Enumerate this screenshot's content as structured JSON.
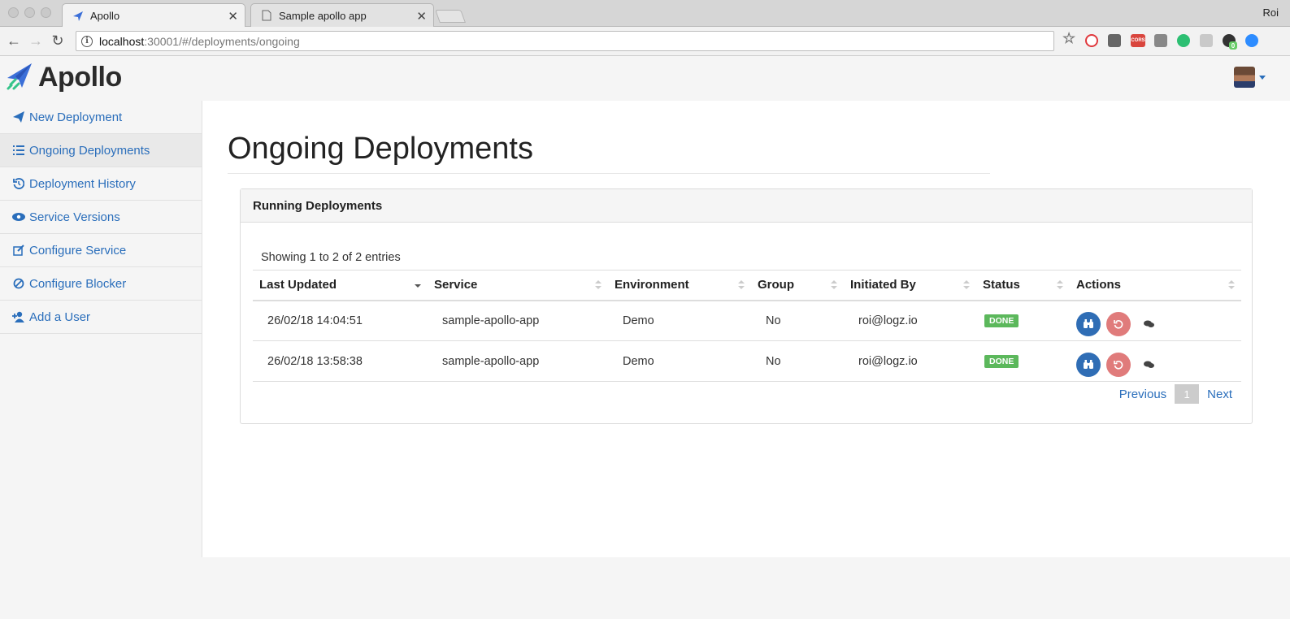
{
  "browser": {
    "tabs": [
      {
        "title": "Apollo",
        "active": true
      },
      {
        "title": "Sample apollo app",
        "active": false
      }
    ],
    "profile_name": "Roi",
    "url_host": "localhost",
    "url_path": ":30001/#/deployments/ongoing",
    "extensions": [
      "star-icon",
      "opera-icon",
      "pocket-icon",
      "cors-icon",
      "mail-icon",
      "grammarly-icon",
      "dropbox-icon",
      "github-icon",
      "zoom-icon"
    ],
    "cors_label": "CORS",
    "github_badge": "0"
  },
  "app": {
    "brand": "Apollo",
    "accent_color": "#2a6ebb"
  },
  "sidebar": {
    "items": [
      {
        "label": "New Deployment",
        "icon": "paper-plane-icon"
      },
      {
        "label": "Ongoing Deployments",
        "icon": "list-icon",
        "active": true
      },
      {
        "label": "Deployment History",
        "icon": "history-icon"
      },
      {
        "label": "Service Versions",
        "icon": "eye-icon"
      },
      {
        "label": "Configure Service",
        "icon": "edit-icon"
      },
      {
        "label": "Configure Blocker",
        "icon": "ban-icon"
      },
      {
        "label": "Add a User",
        "icon": "user-plus-icon"
      }
    ]
  },
  "main": {
    "title": "Ongoing Deployments",
    "panel_title": "Running Deployments",
    "entries_info": "Showing 1 to 2 of 2 entries",
    "columns": [
      "Last Updated",
      "Service",
      "Environment",
      "Group",
      "Initiated By",
      "Status",
      "Actions"
    ],
    "rows": [
      {
        "last_updated": "26/02/18 14:04:51",
        "service": "sample-apollo-app",
        "environment": "Demo",
        "group": "No",
        "initiated_by": "roi@logz.io",
        "status": "DONE"
      },
      {
        "last_updated": "26/02/18 13:58:38",
        "service": "sample-apollo-app",
        "environment": "Demo",
        "group": "No",
        "initiated_by": "roi@logz.io",
        "status": "DONE"
      }
    ],
    "pagination": {
      "previous": "Previous",
      "current": "1",
      "next": "Next"
    }
  }
}
